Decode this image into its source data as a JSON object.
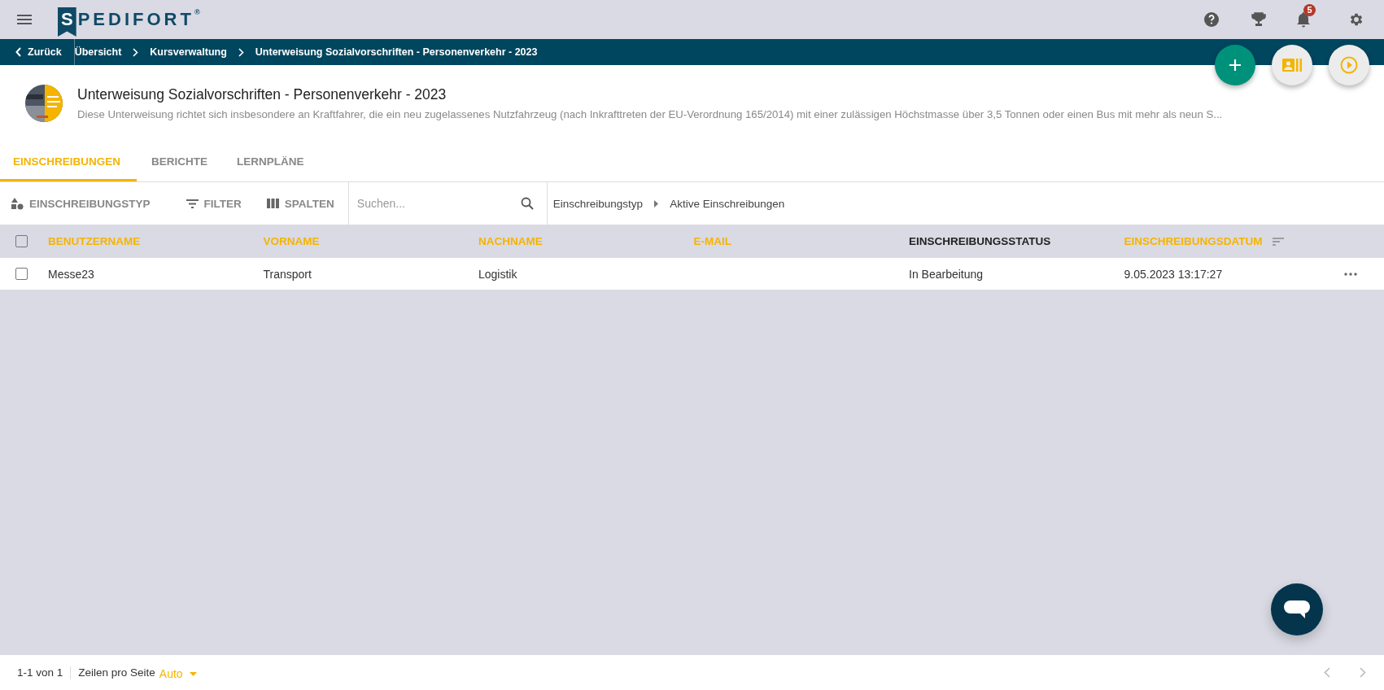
{
  "app_bar": {
    "logo": {
      "initial": "S",
      "rest": "PEDIFORT",
      "mark": "®"
    },
    "notification_count": "5"
  },
  "breadcrumb": {
    "back": "Zurück",
    "items": [
      "Übersicht",
      "Kursverwaltung",
      "Unterweisung Sozialvorschriften - Personenverkehr - 2023"
    ]
  },
  "course": {
    "title": "Unterweisung Sozialvorschriften - Personenverkehr - 2023",
    "description": "Diese Unterweisung richtet sich insbesondere an Kraftfahrer, die ein neu zugelassenes Nutzfahrzeug (nach Inkrafttreten der EU-Verordnung 165/2014) mit einer zulässigen Höchstmasse über 3,5 Tonnen oder einen Bus mit mehr als neun S..."
  },
  "tabs": [
    {
      "label": "EINSCHREIBUNGEN",
      "selected": true
    },
    {
      "label": "BERICHTE",
      "selected": false
    },
    {
      "label": "LERNPLÄNE",
      "selected": false
    }
  ],
  "toolbar": {
    "buttons": [
      {
        "kind": "shapes",
        "label": "EINSCHREIBUNGSTYP"
      },
      {
        "kind": "filter",
        "label": "FILTER"
      },
      {
        "kind": "columns",
        "label": "SPALTEN"
      }
    ],
    "search": {
      "placeholder": "Suchen..."
    },
    "path": [
      "Einschreibungstyp",
      "Aktive Einschreibungen"
    ]
  },
  "table": {
    "all_checked": false,
    "columns": [
      {
        "label": "BENUTZERNAME",
        "sortable": true,
        "sorted": false
      },
      {
        "label": "VORNAME",
        "sortable": true,
        "sorted": false
      },
      {
        "label": "NACHNAME",
        "sortable": true,
        "sorted": false
      },
      {
        "label": "E-MAIL",
        "sortable": true,
        "sorted": false
      },
      {
        "label": "EINSCHREIBUNGSSTATUS",
        "sortable": false,
        "sorted": false
      },
      {
        "label": "EINSCHREIBUNGSDATUM",
        "sortable": true,
        "sorted": true
      }
    ],
    "rows": [
      {
        "checked": false,
        "cells": [
          "Messe23",
          "Transport",
          "Logistik",
          "",
          "In Bearbeitung",
          "9.05.2023 13:17:27"
        ]
      }
    ]
  },
  "pagination": {
    "range": "1-1 von 1",
    "rows_label": "Zeilen pro Seite",
    "rows_value": "Auto"
  }
}
